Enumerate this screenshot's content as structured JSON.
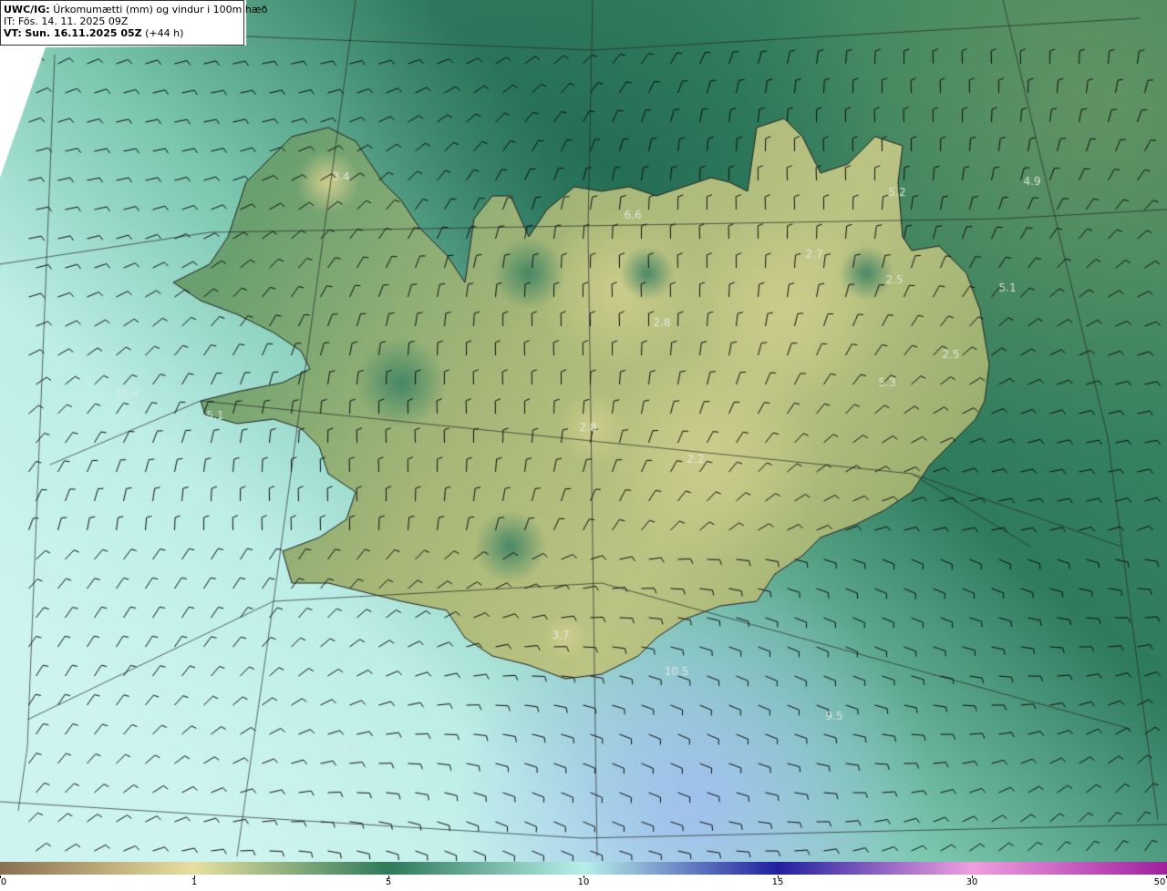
{
  "header": {
    "model": "UWC/IG:",
    "product": "Úrkomumætti (mm) og vindur i 100m hæð",
    "init_label": "IT:",
    "init_time": "Fös. 14. 11. 2025 09Z",
    "valid_label": "VT:",
    "valid_time": "Sun. 16.11.2025 05Z",
    "lead_time": "(+44 h)"
  },
  "map": {
    "point_values": [
      {
        "id": "westfjords",
        "label": "3.4"
      },
      {
        "id": "skagi",
        "label": "6.6"
      },
      {
        "id": "northeast",
        "label": "5.2"
      },
      {
        "id": "offshore-ne",
        "label": "4.9"
      },
      {
        "id": "highland-n",
        "label": "2.7"
      },
      {
        "id": "east-1",
        "label": "2.5"
      },
      {
        "id": "offshore-e",
        "label": "5.1"
      },
      {
        "id": "central-n",
        "label": "2.8"
      },
      {
        "id": "east-2",
        "label": "2.5"
      },
      {
        "id": "east-3",
        "label": "5.3"
      },
      {
        "id": "west-sea",
        "label": "10.4"
      },
      {
        "id": "snaefells",
        "label": "5.1"
      },
      {
        "id": "langjokull",
        "label": "2.8"
      },
      {
        "id": "vatnajokull",
        "label": "2.2"
      },
      {
        "id": "south",
        "label": "3.7"
      },
      {
        "id": "south-sea",
        "label": "10.5"
      },
      {
        "id": "southeast-sea",
        "label": "9.5"
      },
      {
        "id": "southwest-sea",
        "label": "10.4"
      }
    ],
    "colors": {
      "low": "#b8a36a",
      "land": "#c8c888",
      "mid": "#2e7a5a",
      "sea_high": "#c8f0ee",
      "very_high": "#a0b8f0"
    }
  },
  "colorbar": {
    "labels": [
      "0",
      "1",
      "5",
      "10",
      "15",
      "30",
      "50"
    ],
    "stops": [
      "#8a7050",
      "#e8e0a0",
      "#2e7a5a",
      "#b8f0ea",
      "#2020a0",
      "#f0a0e0",
      "#a020a0"
    ]
  }
}
